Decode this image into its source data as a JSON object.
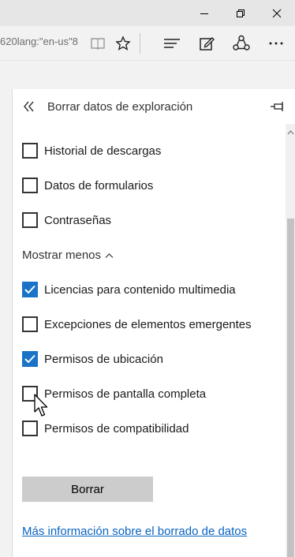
{
  "window": {
    "controls": {
      "minimize_icon": "minimize-icon",
      "restore_icon": "restore-icon",
      "close_icon": "close-icon"
    }
  },
  "toolbar": {
    "address_text": "620lang:\"en-us\"8",
    "icons": [
      "reading-view-icon",
      "favorite-star-icon",
      "hub-icon",
      "web-note-icon",
      "share-icon",
      "more-icon"
    ]
  },
  "panel": {
    "title": "Borrar datos de exploración",
    "back_icon": "double-chevron-left-icon",
    "pin_icon": "pin-icon",
    "options": [
      {
        "label": "Historial de descargas",
        "checked": false
      },
      {
        "label": "Datos de formularios",
        "checked": false
      },
      {
        "label": "Contraseñas",
        "checked": false
      }
    ],
    "show_less_label": "Mostrar menos",
    "extra_options": [
      {
        "label": "Licencias para contenido multimedia",
        "checked": true
      },
      {
        "label": "Excepciones de elementos emergentes",
        "checked": false
      },
      {
        "label": "Permisos de ubicación",
        "checked": true
      },
      {
        "label": "Permisos de pantalla completa",
        "checked": false
      },
      {
        "label": "Permisos de compatibilidad",
        "checked": false
      }
    ],
    "clear_button_label": "Borrar",
    "info_link": "Más información sobre el borrado de datos"
  },
  "colors": {
    "accent": "#1a73c7",
    "link": "#0a64c2",
    "button_bg": "#cccccc"
  }
}
